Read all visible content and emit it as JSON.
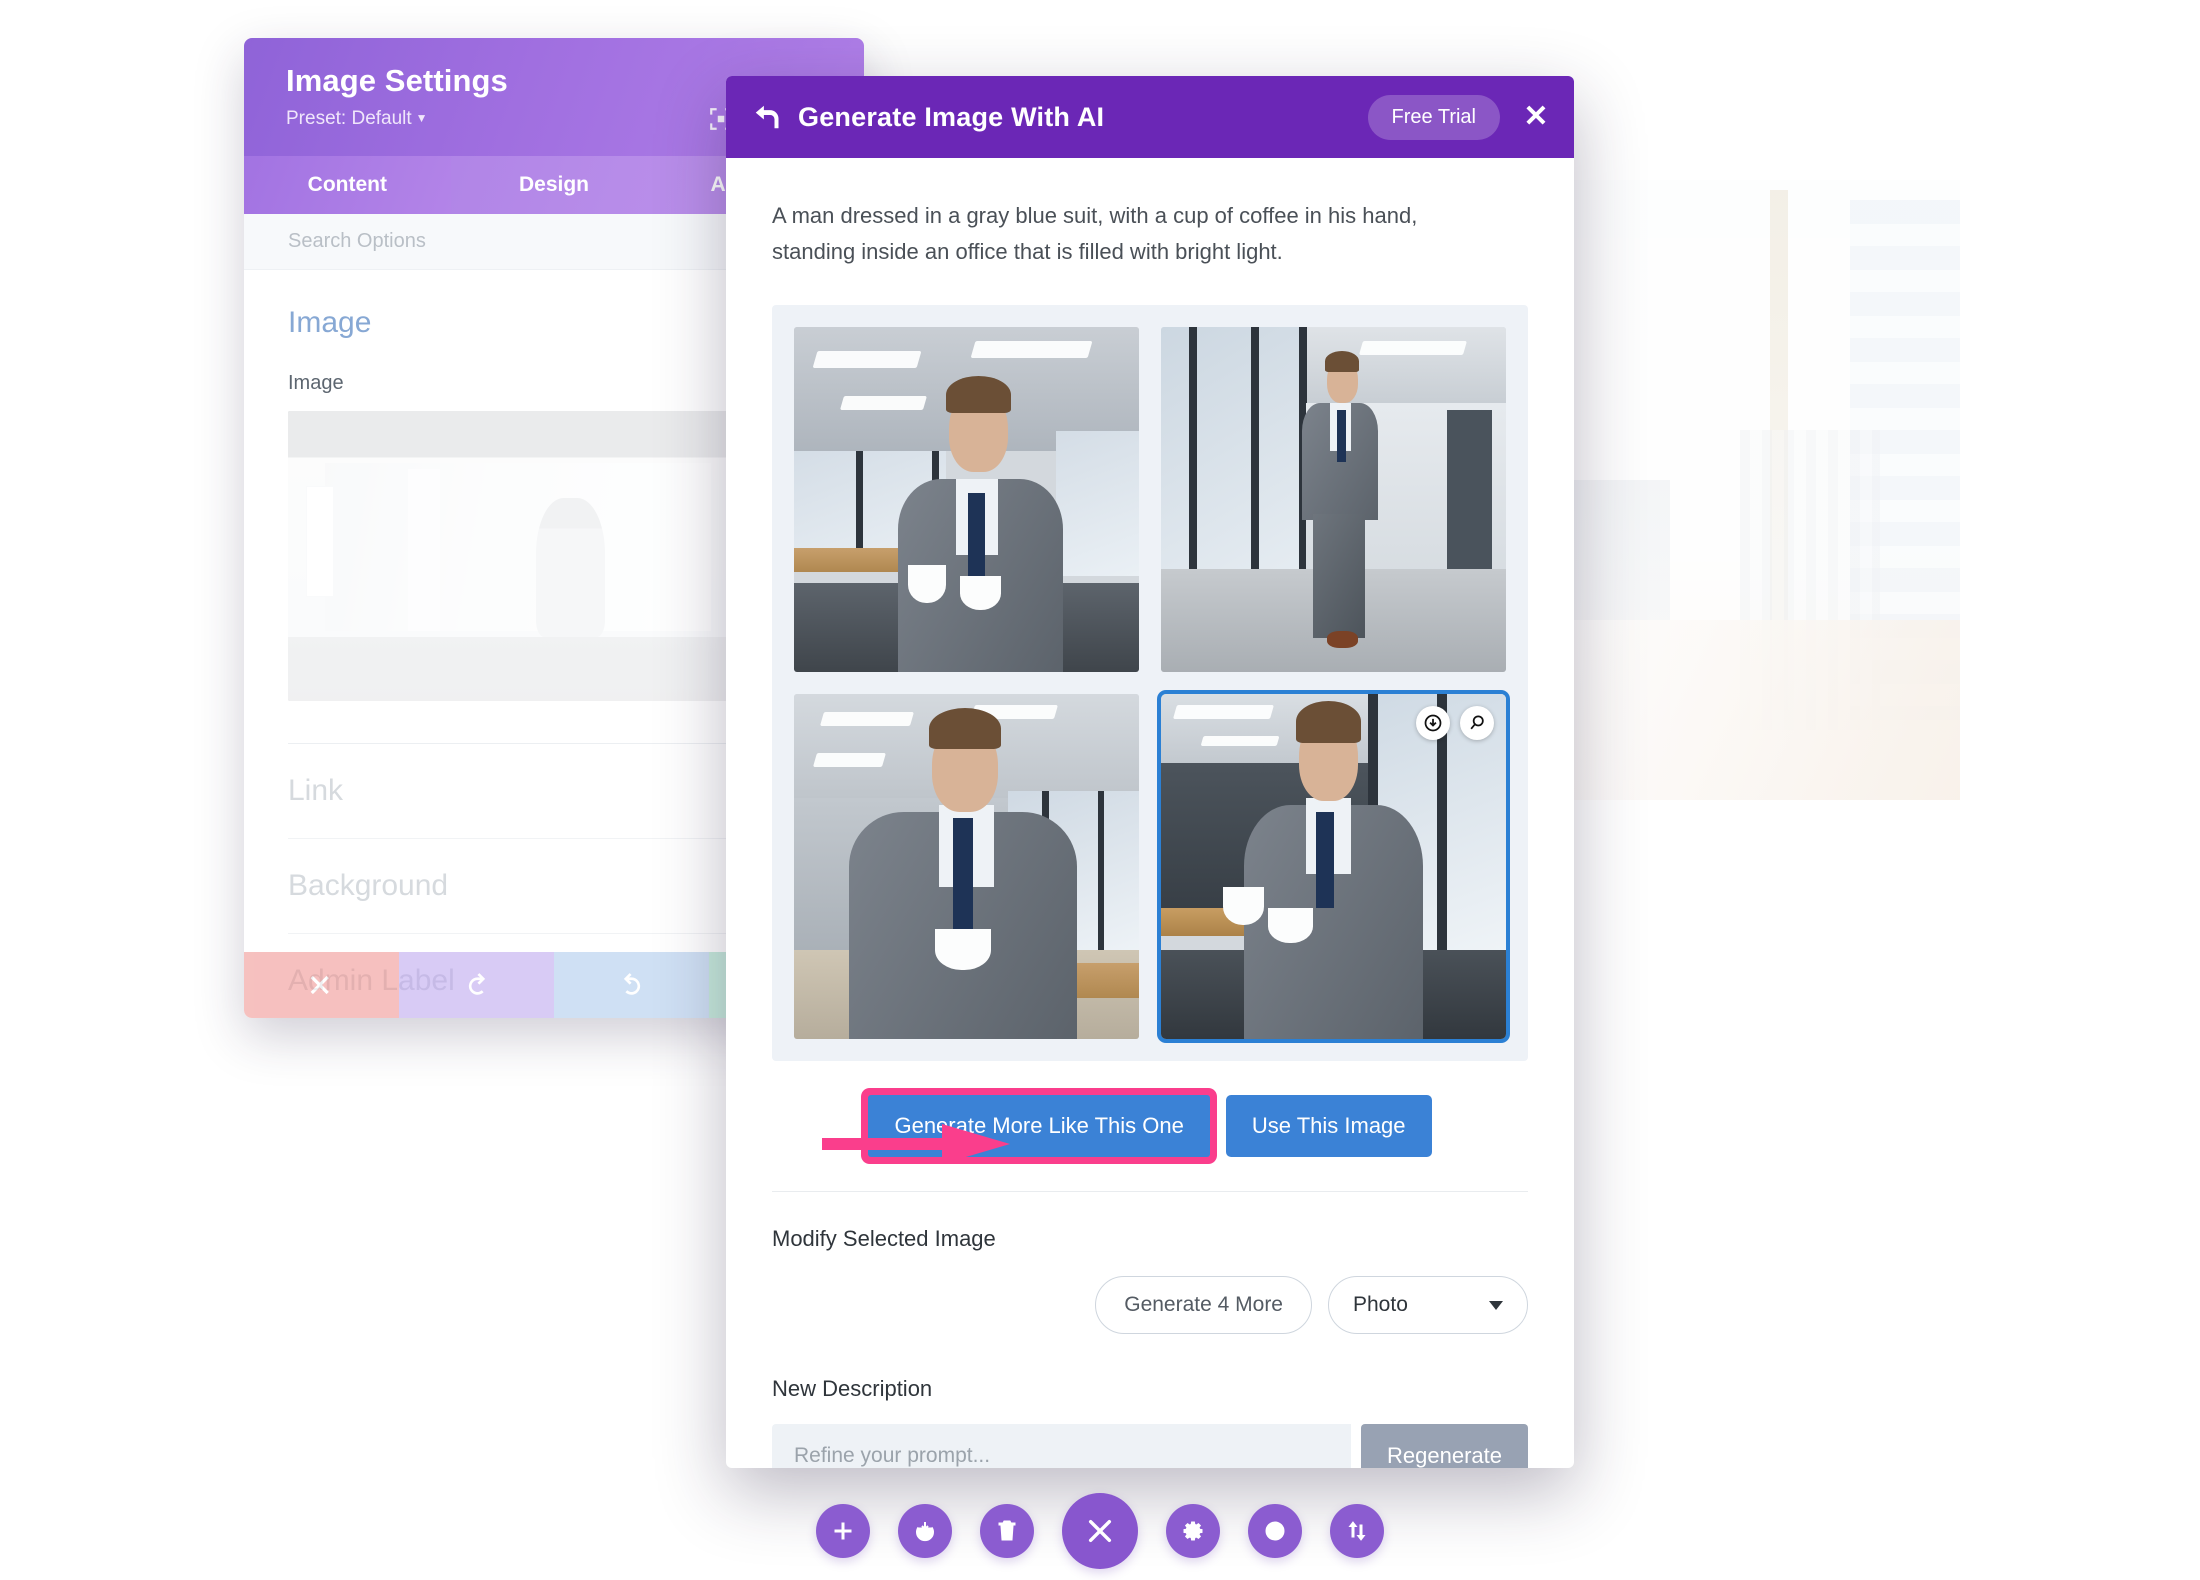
{
  "settings_panel": {
    "title": "Image Settings",
    "preset_label": "Preset: Default",
    "focus_icon": "focus-frame-icon",
    "tabs": [
      {
        "label": "Content",
        "active": true
      },
      {
        "label": "Design",
        "active": false
      },
      {
        "label": "Advanced",
        "active": false
      }
    ],
    "search_placeholder": "Search Options",
    "section_title": "Image",
    "field_label": "Image",
    "collapsed_sections": [
      "Link",
      "Background",
      "Admin Label"
    ],
    "footer_buttons": [
      {
        "name": "discard-button",
        "icon": "close-icon"
      },
      {
        "name": "undo-button",
        "icon": "undo-icon"
      },
      {
        "name": "redo-button",
        "icon": "redo-icon"
      },
      {
        "name": "save-button",
        "icon": "check-icon"
      }
    ]
  },
  "ai_modal": {
    "back_icon": "back-arrow-icon",
    "title": "Generate Image With AI",
    "trial_badge": "Free Trial",
    "close_label": "✕",
    "prompt": "A man dressed in a gray blue suit, with a cup of coffee in his hand, standing inside an office that is filled with bright light.",
    "results": [
      {
        "alt": "Man in gray suit holding two coffee cups in open-plan office",
        "selected": false
      },
      {
        "alt": "Man in gray suit walking down a bright office corridor",
        "selected": false
      },
      {
        "alt": "Man in gray suit holding a white coffee cup in office hallway",
        "selected": false
      },
      {
        "alt": "Man in gray suit with coffee cups beside office window with city view",
        "selected": true
      }
    ],
    "selected_overlay_icons": [
      {
        "name": "download-icon"
      },
      {
        "name": "zoom-search-icon"
      }
    ],
    "annotation_arrow": {
      "name": "pink-annotation-arrow",
      "color": "#FA3E8C"
    },
    "primary_actions": [
      {
        "label": "Generate More Like This One",
        "highlighted": true
      },
      {
        "label": "Use This Image",
        "highlighted": false
      }
    ],
    "modify": {
      "heading": "Modify Selected Image",
      "generate_more_label": "Generate 4 More",
      "style_value": "Photo"
    },
    "new_description": {
      "heading": "New Description",
      "placeholder": "Refine your prompt...",
      "regenerate_label": "Regenerate"
    }
  },
  "toolbar": {
    "buttons": [
      {
        "name": "add-button",
        "icon": "plus-icon"
      },
      {
        "name": "save-draft-button",
        "icon": "power-save-icon"
      },
      {
        "name": "trash-button",
        "icon": "trash-icon"
      },
      {
        "name": "close-builder-button",
        "icon": "close-icon",
        "primary": true
      },
      {
        "name": "settings-button",
        "icon": "gear-icon"
      },
      {
        "name": "history-button",
        "icon": "clock-icon"
      },
      {
        "name": "responsive-button",
        "icon": "sort-updown-icon"
      }
    ]
  },
  "colors": {
    "modal_header": "#6B27B6",
    "panel_header": "#A06FE0",
    "accent_blue": "#3B82D6",
    "highlight_pink": "#FA3E8C",
    "selected_border": "#2B80D4",
    "grid_bg": "#EEF2F7"
  }
}
